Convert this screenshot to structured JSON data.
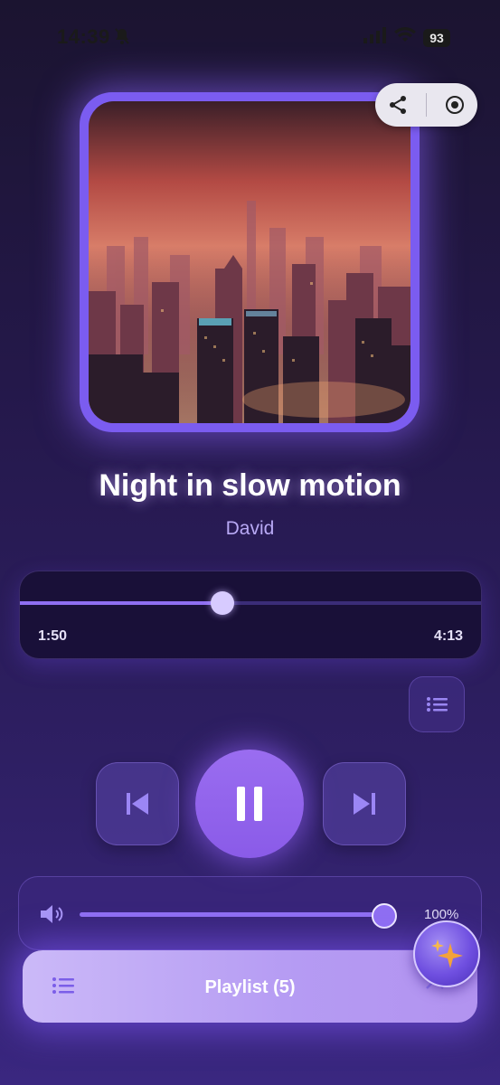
{
  "status": {
    "time": "14:39",
    "battery": "93"
  },
  "song": {
    "title": "Night in slow motion",
    "artist": "David"
  },
  "progress": {
    "current": "1:50",
    "total": "4:13",
    "fraction": 0.44
  },
  "volume": {
    "label": "100%",
    "fraction": 1.0
  },
  "playlist": {
    "label": "Playlist (5)"
  },
  "icons": {
    "share": "share-icon",
    "record": "record-icon",
    "queue": "list-icon",
    "prev": "skip-previous-icon",
    "play": "pause-icon",
    "next": "skip-next-icon",
    "volume": "speaker-icon",
    "ai": "sparkle-icon"
  },
  "colors": {
    "accent": "#8f6ff2",
    "title_glow": "#c8aaff",
    "playlist_bg": "#c2aef6"
  }
}
